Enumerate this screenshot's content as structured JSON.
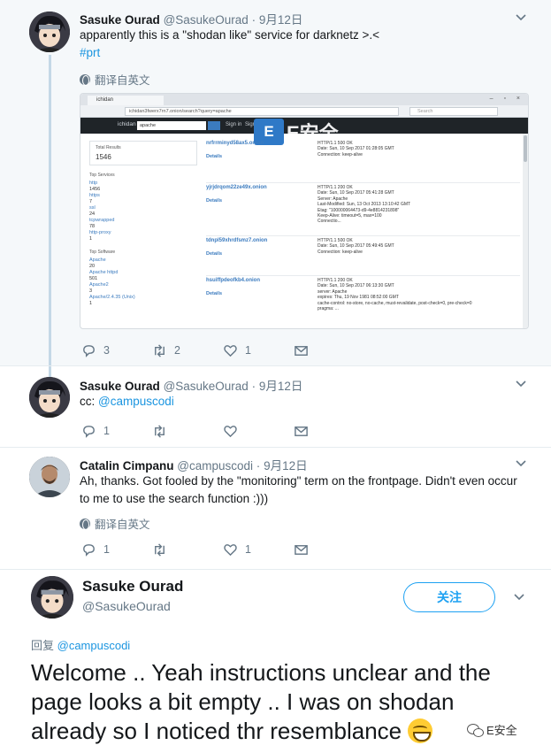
{
  "tweets": [
    {
      "name": "Sasuke Ourad",
      "handle": "@SasukeOurad",
      "dot": "·",
      "date": "9月12日",
      "text": "apparently this is a \"shodan like\" service for darknetz >.<",
      "hashtag": "#prt",
      "translate": "翻译自英文",
      "replies": "3",
      "retweets": "2",
      "likes": "1"
    },
    {
      "name": "Sasuke Ourad",
      "handle": "@SasukeOurad",
      "dot": "·",
      "date": "9月12日",
      "text_prefix": "cc: ",
      "mention": "@campuscodi",
      "replies": "1",
      "retweets": "",
      "likes": ""
    },
    {
      "name": "Catalin Cimpanu",
      "handle": "@campuscodi",
      "dot": "·",
      "date": "9月12日",
      "text": "Ah, thanks. Got fooled by the \"monitoring\" term on the frontpage. Didn't even occur to me to use the search function :)))",
      "translate": "翻译自英文",
      "replies": "1",
      "retweets": "",
      "likes": "1"
    }
  ],
  "screenshot": {
    "tab_title": "ichidan",
    "url": "ichidan3fwerx7rn7.onion/search?query=apache",
    "search_placeholder": "Search",
    "site_logo": "ichidan",
    "query": "apache",
    "nav": [
      "Sign in",
      "Sign up"
    ],
    "watermark_letter": "E",
    "watermark_text": "E安全",
    "total_results_label": "Total Results",
    "total_results": "1546",
    "top_services_label": "Top Services",
    "services": [
      [
        "http",
        "1456"
      ],
      [
        "https",
        "7"
      ],
      [
        "ssl",
        "24"
      ],
      [
        "tcpwrapped",
        "78"
      ],
      [
        "http-proxy",
        "1"
      ]
    ],
    "top_software_label": "Top Software",
    "software": [
      [
        "Apache",
        "20"
      ],
      [
        "Apache httpd",
        "501"
      ],
      [
        "Apache2",
        "3"
      ],
      [
        "Apache/2.4.35 (Unix)",
        "1"
      ]
    ],
    "results": [
      {
        "host": "nrfrrminyd58ax5.onion",
        "details": "Details",
        "body": "HTTP/1.1 500 OK\nDate: Sun, 10 Sep 2017 01:28:05 GMT\nConnection: keep-alive"
      },
      {
        "host": "yjrjdrqom22ze49x.onion",
        "details": "Details",
        "body": "HTTP/1.1 200 OK\nDate: Sun, 10 Sep 2017 05:41:28 GMT\nServer: Apache\nLast-Modified: Sun, 13 Oct 2013 13:10:42 GMT\nEtag: \"100000064473-d9-4e8814231898\"\nKeep-Alive: timeout=5, max=100\nConnectio..."
      },
      {
        "host": "tdnpl59xhrdfsmz7.onion",
        "details": "Details",
        "body": "HTTP/1.1 500 OK\nDate: Sun, 10 Sep 2017 05:49:45 GMT\nConnection: keep-alive"
      },
      {
        "host": "hsuiffpdeofkb4.onion",
        "details": "Details",
        "body": "HTTP/1.1 200 OK\nDate: Sun, 10 Sep 2017 06:13:30 GMT\nserver: Apache\nexpires: Thu, 19 Nov 1981 08:52:00 GMT\ncache-control: no-store, no-cache, must-revalidate, post-check=0, pre-check=0\npragma: ..."
      }
    ]
  },
  "main_tweet": {
    "name": "Sasuke Ourad",
    "handle": "@SasukeOurad",
    "follow_label": "关注",
    "reply_label": "回复 ",
    "reply_mention": "@campuscodi",
    "text": "Welcome .. Yeah instructions unclear and the page looks a bit empty .. I was on shodan already so I noticed thr resemblance ",
    "emoji": "grinning-face",
    "watermark": "E安全"
  },
  "icons": {
    "reply": "reply-icon",
    "retweet": "retweet-icon",
    "like": "heart-icon",
    "dm": "envelope-icon",
    "caret": "chevron-down-icon",
    "globe": "globe-icon"
  },
  "colors": {
    "link": "#1b95e0",
    "secondary": "#657786",
    "thread_bg": "#f5f8fa",
    "follow": "#1da1f2"
  }
}
